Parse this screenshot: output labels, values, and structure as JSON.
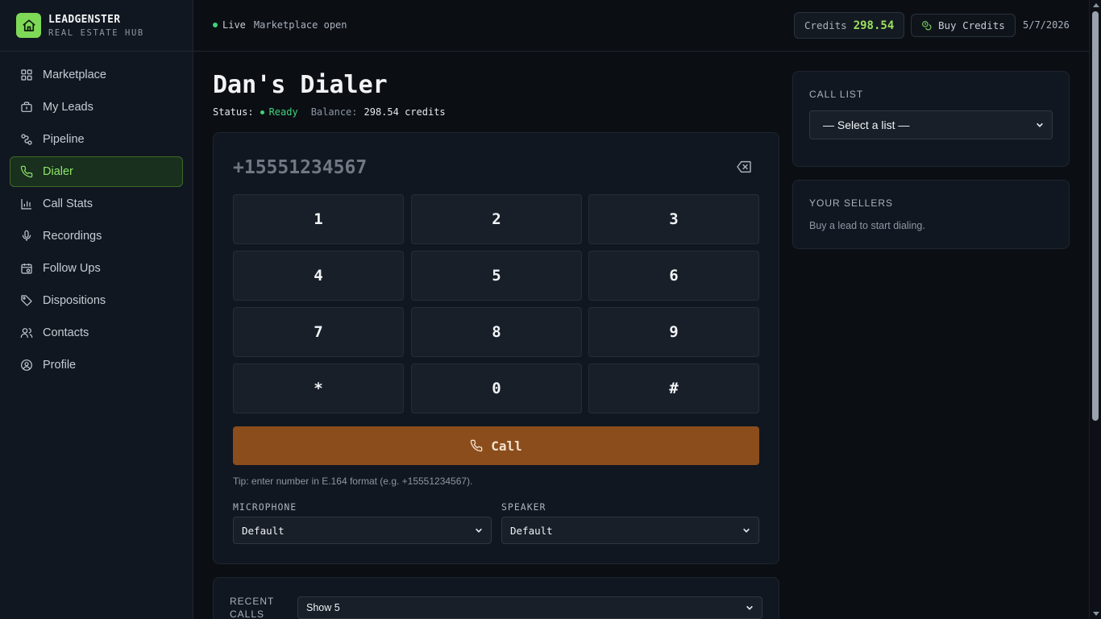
{
  "brand": {
    "name": "LEADGENSTER",
    "subtitle": "REAL ESTATE HUB"
  },
  "sidebar": {
    "items": [
      {
        "label": "Marketplace",
        "icon": "grid-icon"
      },
      {
        "label": "My Leads",
        "icon": "briefcase-icon"
      },
      {
        "label": "Pipeline",
        "icon": "pipeline-icon"
      },
      {
        "label": "Dialer",
        "icon": "phone-icon",
        "active": true
      },
      {
        "label": "Call Stats",
        "icon": "bar-chart-icon"
      },
      {
        "label": "Recordings",
        "icon": "microphone-icon"
      },
      {
        "label": "Follow Ups",
        "icon": "calendar-icon"
      },
      {
        "label": "Dispositions",
        "icon": "tag-icon"
      },
      {
        "label": "Contacts",
        "icon": "users-icon"
      },
      {
        "label": "Profile",
        "icon": "user-circle-icon"
      }
    ]
  },
  "topbar": {
    "live_label": "Live",
    "market_status": "Marketplace open",
    "credits_label": "Credits",
    "credits_value": "298.54",
    "buy_label": "Buy Credits",
    "date": "5/7/2026"
  },
  "header": {
    "title": "Dan's Dialer",
    "status_label": "Status:",
    "status_value": "Ready",
    "balance_label": "Balance:",
    "balance_value": "298.54 credits"
  },
  "dialer": {
    "number_placeholder": "+15551234567",
    "keys": [
      "1",
      "2",
      "3",
      "4",
      "5",
      "6",
      "7",
      "8",
      "9",
      "*",
      "0",
      "#"
    ],
    "call_label": "Call",
    "tip": "Tip: enter number in E.164 format (e.g. +15551234567).",
    "microphone_label": "MICROPHONE",
    "microphone_value": "Default",
    "speaker_label": "SPEAKER",
    "speaker_value": "Default"
  },
  "recent_calls": {
    "label": "RECENT CALLS",
    "show_value": "Show 5"
  },
  "call_list": {
    "title": "CALL LIST",
    "select_value": "— Select a list —"
  },
  "sellers": {
    "title": "YOUR SELLERS",
    "empty_text": "Buy a lead to start dialing."
  },
  "colors": {
    "accent": "#7ed957",
    "call_button": "#8b4d1b",
    "live": "#3fd27a",
    "background": "#0b0f14"
  }
}
